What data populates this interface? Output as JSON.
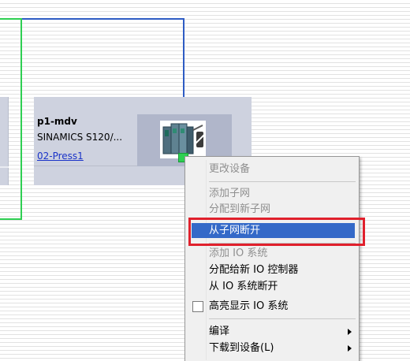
{
  "device": {
    "name": "p1-mdv",
    "type": "SINAMICS S120/...",
    "network_link": "02-Press1"
  },
  "context_menu": {
    "change_device": "更改设备",
    "add_subnet": "添加子网",
    "assign_new_subnet": "分配到新子网",
    "disconnect_subnet": "从子网断开",
    "add_io_system": "添加 IO 系统",
    "assign_new_io_controller": "分配给新 IO 控制器",
    "disconnect_io_system": "从 IO 系统断开",
    "highlight_io_system": "高亮显示 IO 系统",
    "compile": "编译",
    "download_to_device": "下载到设备(L)"
  },
  "colors": {
    "subnet_line": "#2ecf52",
    "io_line": "#2e5cc4",
    "selection": "#3469c8",
    "highlight_frame": "#e0202c"
  }
}
